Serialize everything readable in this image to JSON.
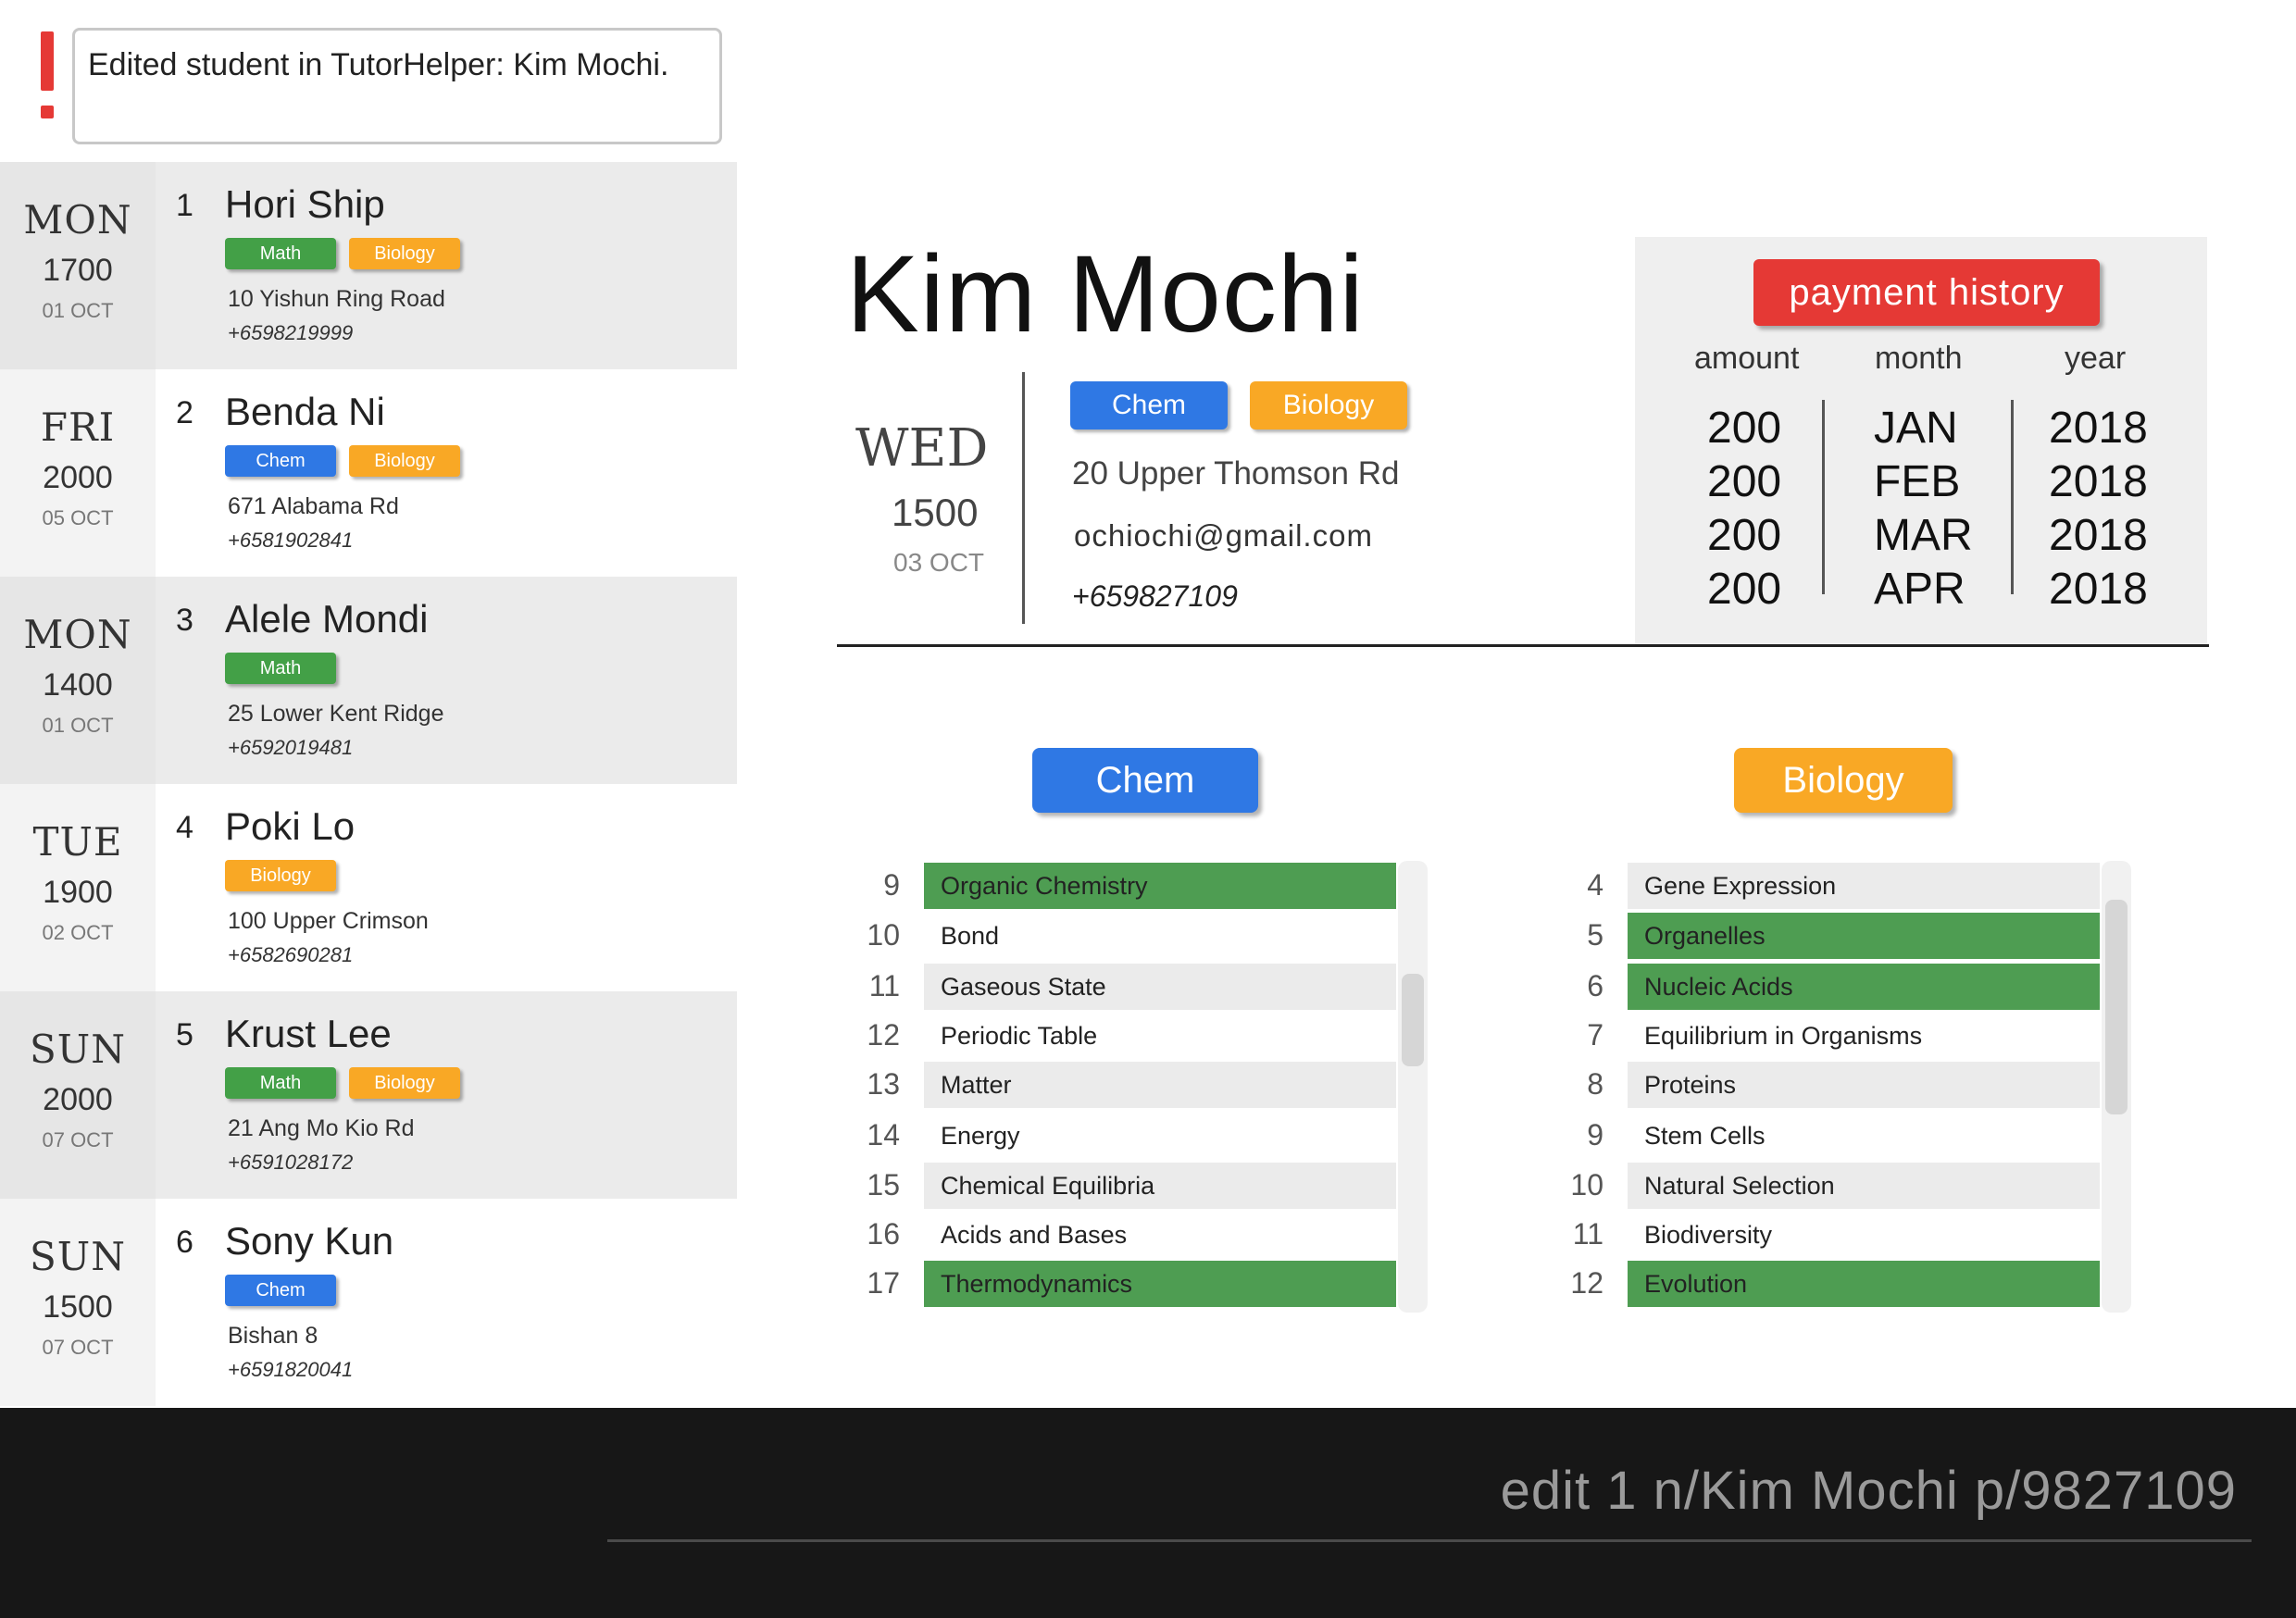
{
  "result_message": "Edited student in TutorHelper: Kim Mochi.",
  "students": [
    {
      "index": "1",
      "name": "Hori Ship",
      "day": "MON",
      "time": "1700",
      "date": "01 OCT",
      "tags": [
        {
          "label": "Math",
          "kind": "math"
        },
        {
          "label": "Biology",
          "kind": "bio"
        }
      ],
      "address": "10 Yishun Ring Road",
      "phone": "+6598219999"
    },
    {
      "index": "2",
      "name": "Benda Ni",
      "day": "FRI",
      "time": "2000",
      "date": "05 OCT",
      "tags": [
        {
          "label": "Chem",
          "kind": "chem"
        },
        {
          "label": "Biology",
          "kind": "bio"
        }
      ],
      "address": "671 Alabama Rd",
      "phone": "+6581902841"
    },
    {
      "index": "3",
      "name": "Alele Mondi",
      "day": "MON",
      "time": "1400",
      "date": "01 OCT",
      "tags": [
        {
          "label": "Math",
          "kind": "math"
        }
      ],
      "address": "25 Lower Kent Ridge",
      "phone": "+6592019481"
    },
    {
      "index": "4",
      "name": "Poki Lo",
      "day": "TUE",
      "time": "1900",
      "date": "02 OCT",
      "tags": [
        {
          "label": "Biology",
          "kind": "bio"
        }
      ],
      "address": "100 Upper Crimson",
      "phone": "+6582690281"
    },
    {
      "index": "5",
      "name": "Krust Lee",
      "day": "SUN",
      "time": "2000",
      "date": "07 OCT",
      "tags": [
        {
          "label": "Math",
          "kind": "math"
        },
        {
          "label": "Biology",
          "kind": "bio"
        }
      ],
      "address": "21 Ang Mo Kio Rd",
      "phone": "+6591028172"
    },
    {
      "index": "6",
      "name": "Sony Kun",
      "day": "SUN",
      "time": "1500",
      "date": "07 OCT",
      "tags": [
        {
          "label": "Chem",
          "kind": "chem"
        }
      ],
      "address": "Bishan 8",
      "phone": "+6591820041"
    }
  ],
  "detail": {
    "name": "Kim Mochi",
    "day": "WED",
    "time": "1500",
    "date": "03 OCT",
    "tags": [
      {
        "label": "Chem",
        "kind": "chem"
      },
      {
        "label": "Biology",
        "kind": "bio"
      }
    ],
    "address": "20 Upper Thomson Rd",
    "email": "ochiochi@gmail.com",
    "phone": "+659827109"
  },
  "payment": {
    "button_label": "payment history",
    "headers": {
      "amount": "amount",
      "month": "month",
      "year": "year"
    },
    "rows": [
      {
        "amount": "200",
        "month": "JAN",
        "year": "2018"
      },
      {
        "amount": "200",
        "month": "FEB",
        "year": "2018"
      },
      {
        "amount": "200",
        "month": "MAR",
        "year": "2018"
      },
      {
        "amount": "200",
        "month": "APR",
        "year": "2018"
      }
    ]
  },
  "subjects": {
    "chem": {
      "label": "Chem",
      "topics": [
        {
          "num": "9",
          "name": "Organic Chemistry",
          "done": true
        },
        {
          "num": "10",
          "name": "Bond",
          "done": false
        },
        {
          "num": "11",
          "name": "Gaseous State",
          "done": false
        },
        {
          "num": "12",
          "name": "Periodic Table",
          "done": false
        },
        {
          "num": "13",
          "name": "Matter",
          "done": false
        },
        {
          "num": "14",
          "name": "Energy",
          "done": false
        },
        {
          "num": "15",
          "name": "Chemical Equilibria",
          "done": false
        },
        {
          "num": "16",
          "name": "Acids and Bases",
          "done": false
        },
        {
          "num": "17",
          "name": "Thermodynamics",
          "done": true
        }
      ]
    },
    "bio": {
      "label": "Biology",
      "topics": [
        {
          "num": "4",
          "name": "Gene Expression",
          "done": false
        },
        {
          "num": "5",
          "name": "Organelles",
          "done": true
        },
        {
          "num": "6",
          "name": "Nucleic Acids",
          "done": true
        },
        {
          "num": "7",
          "name": "Equilibrium in Organisms",
          "done": false
        },
        {
          "num": "8",
          "name": "Proteins",
          "done": false
        },
        {
          "num": "9",
          "name": "Stem Cells",
          "done": false
        },
        {
          "num": "10",
          "name": "Natural Selection",
          "done": false
        },
        {
          "num": "11",
          "name": "Biodiversity",
          "done": false
        },
        {
          "num": "12",
          "name": "Evolution",
          "done": true
        }
      ]
    }
  },
  "command": "edit 1 n/Kim Mochi p/9827109"
}
